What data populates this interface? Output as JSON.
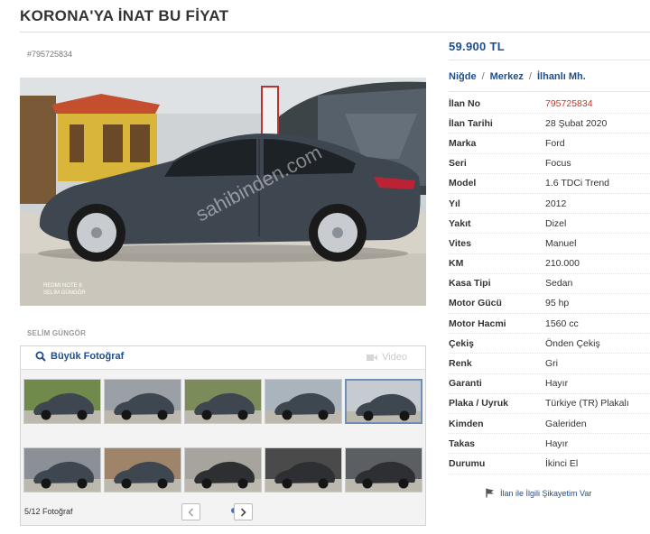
{
  "header": {
    "title": "KORONA'YA İNAT BU FİYAT"
  },
  "listing": {
    "id_label": "#795725834",
    "owner": "SELİM GÜNGÖR",
    "price": "59.900 TL"
  },
  "location": {
    "city": "Niğde",
    "district": "Merkez",
    "neighborhood": "İlhanlı Mh.",
    "separator": "/"
  },
  "photo": {
    "watermark": "sahibinden.com",
    "overlay_line1": "REDMI NOTE 8",
    "overlay_line2": "SELİM GÜNGÖR"
  },
  "gallery": {
    "big_photo_label": "Büyük Fotoğraf",
    "video_label": "Video",
    "counter": "5/12 Fotoğraf",
    "active_index": 4,
    "page_count": 2,
    "current_page": 1
  },
  "details": [
    {
      "key": "İlan No",
      "value": "795725834",
      "highlight": true
    },
    {
      "key": "İlan Tarihi",
      "value": "28 Şubat 2020"
    },
    {
      "key": "Marka",
      "value": "Ford"
    },
    {
      "key": "Seri",
      "value": "Focus"
    },
    {
      "key": "Model",
      "value": "1.6 TDCi Trend"
    },
    {
      "key": "Yıl",
      "value": "2012"
    },
    {
      "key": "Yakıt",
      "value": "Dizel"
    },
    {
      "key": "Vites",
      "value": "Manuel"
    },
    {
      "key": "KM",
      "value": "210.000"
    },
    {
      "key": "Kasa Tipi",
      "value": "Sedan"
    },
    {
      "key": "Motor Gücü",
      "value": "95 hp"
    },
    {
      "key": "Motor Hacmi",
      "value": "1560 cc"
    },
    {
      "key": "Çekiş",
      "value": "Önden Çekiş"
    },
    {
      "key": "Renk",
      "value": "Gri"
    },
    {
      "key": "Garanti",
      "value": "Hayır"
    },
    {
      "key": "Plaka / Uyruk",
      "value": "Türkiye (TR) Plakalı"
    },
    {
      "key": "Kimden",
      "value": "Galeriden"
    },
    {
      "key": "Takas",
      "value": "Hayır"
    },
    {
      "key": "Durumu",
      "value": "İkinci El"
    }
  ],
  "complaint": {
    "label": "İlan ile İlgili Şikayetim Var"
  },
  "colors": {
    "link_blue": "#1e4e8c",
    "id_red": "#c0392b",
    "active_dot": "#4b73a8"
  }
}
